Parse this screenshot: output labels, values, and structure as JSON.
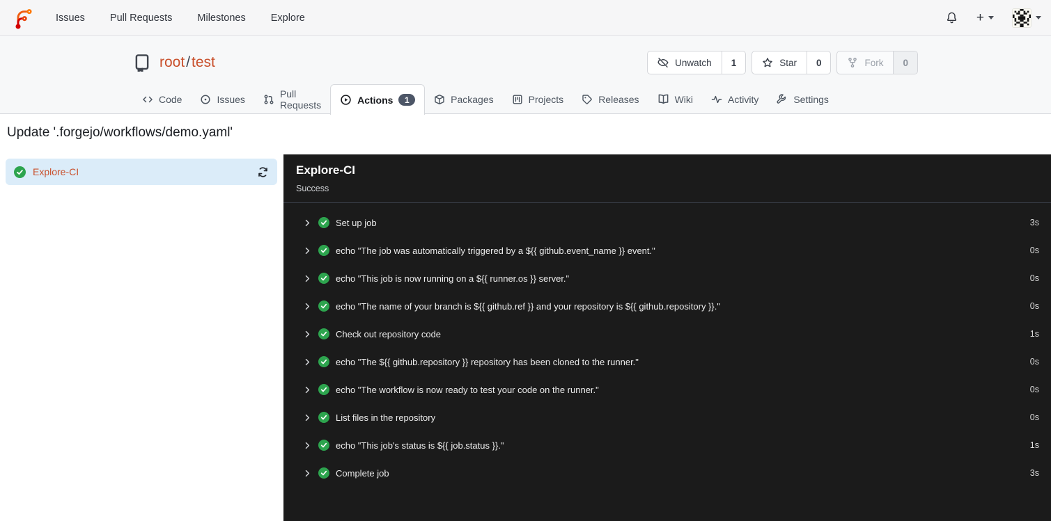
{
  "colors": {
    "accent_orange": "#c9502c",
    "success_green": "#2da44e",
    "panel_bg": "#1b1b1b",
    "selected_row_blue": "#dbecf9",
    "badge_slate": "#4d5667"
  },
  "navbar": {
    "logo_icon": "forgejo-logo-icon",
    "items": [
      {
        "label": "Issues"
      },
      {
        "label": "Pull Requests"
      },
      {
        "label": "Milestones"
      },
      {
        "label": "Explore"
      }
    ],
    "right": {
      "bell_icon": "bell-icon",
      "plus_label": "+",
      "avatar_icon": "user-avatar-identicon"
    }
  },
  "repo": {
    "icon": "repository-book-icon",
    "owner": "root",
    "separator": "/",
    "name": "test",
    "buttons": [
      {
        "icon": "eye-slash-icon",
        "label": "Unwatch",
        "count": "1"
      },
      {
        "icon": "star-icon",
        "label": "Star",
        "count": "0"
      },
      {
        "icon": "fork-icon",
        "label": "Fork",
        "count": "0",
        "disabled": true
      }
    ],
    "tabs": [
      {
        "icon": "code-icon",
        "label": "Code"
      },
      {
        "icon": "issue-circle-icon",
        "label": "Issues"
      },
      {
        "icon": "pull-request-icon",
        "label": "Pull Requests"
      },
      {
        "icon": "play-circle-icon",
        "label": "Actions",
        "badge": "1",
        "active": true
      },
      {
        "icon": "package-icon",
        "label": "Packages"
      },
      {
        "icon": "project-board-icon",
        "label": "Projects"
      },
      {
        "icon": "tag-icon",
        "label": "Releases"
      },
      {
        "icon": "book-open-icon",
        "label": "Wiki"
      },
      {
        "icon": "pulse-icon",
        "label": "Activity"
      },
      {
        "icon": "wrench-icon",
        "label": "Settings"
      }
    ]
  },
  "run": {
    "title": "Update '.forgejo/workflows/demo.yaml'",
    "sidebar": {
      "job_status_icon": "success-check-icon",
      "job_label": "Explore-CI",
      "refresh_icon": "refresh-sync-icon"
    },
    "panel": {
      "title": "Explore-CI",
      "status": "Success",
      "steps": [
        {
          "label": "Set up job",
          "duration": "3s"
        },
        {
          "label": "echo \"The job was automatically triggered by a ${{ github.event_name }} event.\"",
          "duration": "0s"
        },
        {
          "label": "echo \"This job is now running on a ${{ runner.os }} server.\"",
          "duration": "0s"
        },
        {
          "label": "echo \"The name of your branch is ${{ github.ref }} and your repository is ${{ github.repository }}.\"",
          "duration": "0s"
        },
        {
          "label": "Check out repository code",
          "duration": "1s"
        },
        {
          "label": "echo \"The ${{ github.repository }} repository has been cloned to the runner.\"",
          "duration": "0s"
        },
        {
          "label": "echo \"The workflow is now ready to test your code on the runner.\"",
          "duration": "0s"
        },
        {
          "label": "List files in the repository",
          "duration": "0s"
        },
        {
          "label": "echo \"This job's status is ${{ job.status }}.\"",
          "duration": "1s"
        },
        {
          "label": "Complete job",
          "duration": "3s"
        }
      ]
    }
  }
}
